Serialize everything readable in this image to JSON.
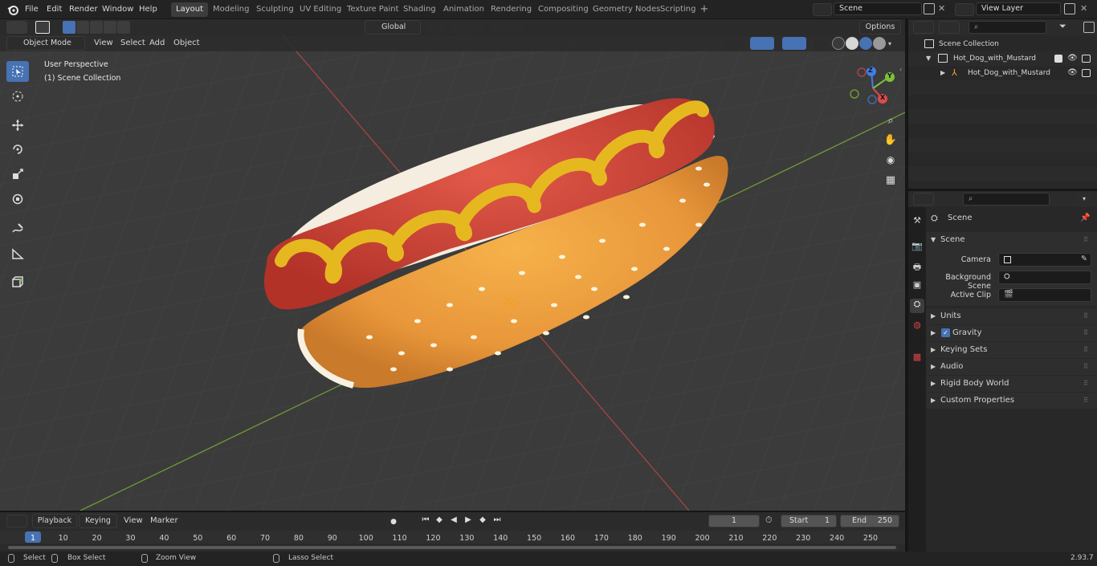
{
  "topbar": {
    "menu": [
      "File",
      "Edit",
      "Render",
      "Window",
      "Help"
    ],
    "workspaces": [
      "Layout",
      "Modeling",
      "Sculpting",
      "UV Editing",
      "Texture Paint",
      "Shading",
      "Animation",
      "Rendering",
      "Compositing",
      "Geometry Nodes",
      "Scripting"
    ],
    "scene": "Scene",
    "view_layer": "View Layer"
  },
  "viewport_header": {
    "mode": "Object Mode",
    "menu": [
      "View",
      "Select",
      "Add",
      "Object"
    ],
    "transform_orientation": "Global",
    "options": "Options"
  },
  "viewport": {
    "perspective": "User Perspective",
    "collection": "(1) Scene Collection",
    "gizmo_axes": [
      "Z",
      "Y",
      "X"
    ]
  },
  "outliner": {
    "search_placeholder": "",
    "root": "Scene Collection",
    "collection": "Hot_Dog_with_Mustard",
    "object": "Hot_Dog_with_Mustard"
  },
  "properties": {
    "tab_title": "Scene",
    "panel": "Scene",
    "camera_label": "Camera",
    "background_label": "Background Scene",
    "clip_label": "Active Clip",
    "sections": [
      "Units",
      "Gravity",
      "Keying Sets",
      "Audio",
      "Rigid Body World",
      "Custom Properties"
    ]
  },
  "timeline": {
    "menu": [
      "Playback",
      "Keying",
      "View",
      "Marker"
    ],
    "current_frame": "1",
    "start_label": "Start",
    "start": "1",
    "end_label": "End",
    "end": "250",
    "ticks": [
      "1",
      "10",
      "20",
      "30",
      "40",
      "50",
      "60",
      "70",
      "80",
      "90",
      "100",
      "110",
      "120",
      "130",
      "140",
      "150",
      "160",
      "170",
      "180",
      "190",
      "200",
      "210",
      "220",
      "230",
      "240",
      "250"
    ]
  },
  "status": {
    "select": "Select",
    "box_select": "Box Select",
    "zoom_view": "Zoom View",
    "lasso_select": "Lasso Select",
    "version": "2.93.7"
  },
  "colors": {
    "accent": "#4772b3",
    "x_axis": "#e04a4a",
    "y_axis": "#7dbf3a",
    "z_axis": "#3f7fe6",
    "mustard": "#e6b820",
    "sausage": "#d8463a",
    "bun": "#f2a43a"
  }
}
